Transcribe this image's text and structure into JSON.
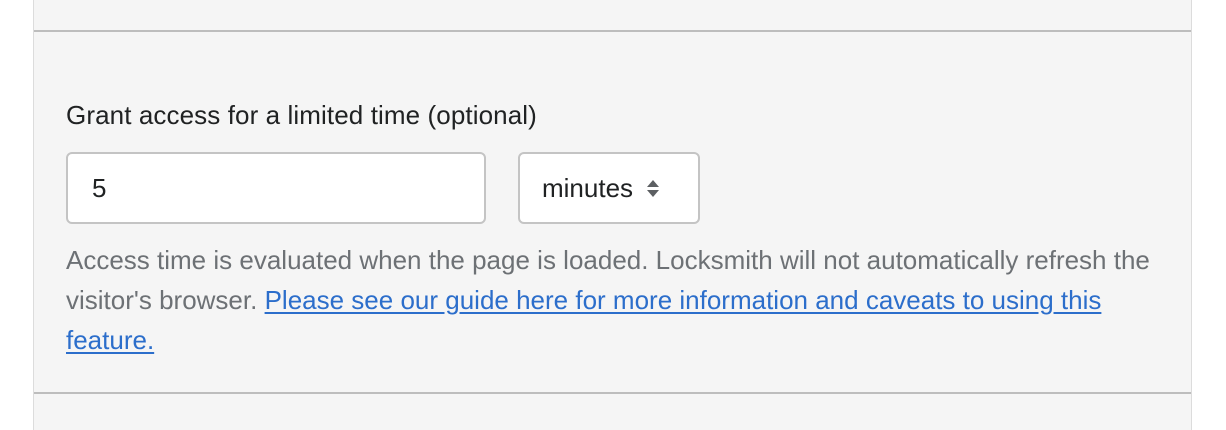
{
  "field": {
    "label": "Grant access for a limited time (optional)",
    "duration_value": "5",
    "unit_selected": "minutes"
  },
  "help": {
    "text": "Access time is evaluated when the page is loaded. Locksmith will not automatically refresh the visitor's browser. ",
    "link_text": "Please see our guide here for more information and caveats to using this feature."
  },
  "colors": {
    "panel_background": "#f5f5f5",
    "text_primary": "#202223",
    "text_secondary": "#6d7175",
    "link": "#2c6ecb",
    "border": "#c4c4c4"
  }
}
